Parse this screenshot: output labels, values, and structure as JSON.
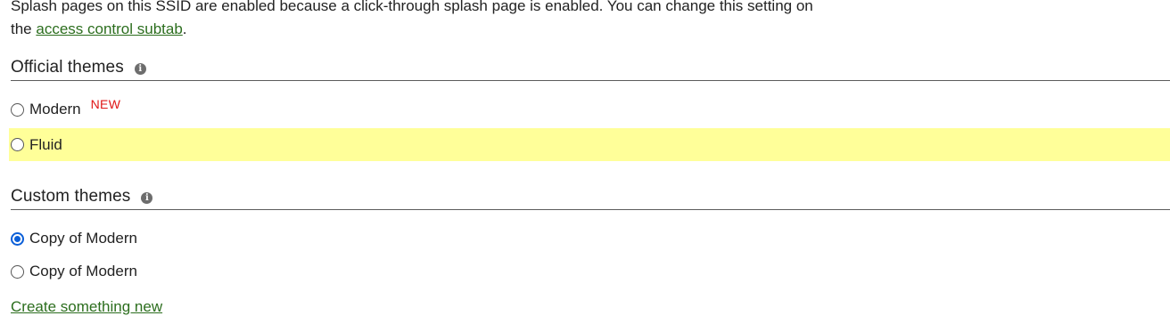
{
  "notice": {
    "text_before": "Splash pages on this SSID are enabled because a click-through splash page is enabled. You can change this setting on the ",
    "link_text": "access control subtab",
    "text_after": "."
  },
  "official_themes": {
    "title": "Official themes",
    "info_icon": "info-icon",
    "options": [
      {
        "label": "Modern",
        "badge": "NEW",
        "selected": false,
        "highlighted": false
      },
      {
        "label": "Fluid",
        "selected": false,
        "highlighted": true
      }
    ]
  },
  "custom_themes": {
    "title": "Custom themes",
    "info_icon": "info-icon",
    "options": [
      {
        "label": "Copy of Modern",
        "selected": true
      },
      {
        "label": "Copy of Modern",
        "selected": false
      }
    ]
  },
  "create_link": "Create something new",
  "colors": {
    "link": "#2c6e1e",
    "highlight": "#ffff99",
    "badge": "#e01616",
    "radio_selected": "#0b5fd8"
  }
}
